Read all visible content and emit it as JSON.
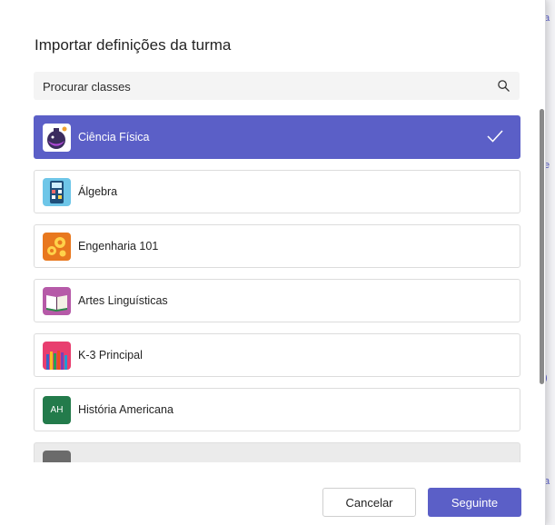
{
  "dialog": {
    "title": "Importar definições da turma",
    "search_placeholder": "Procurar classes",
    "cancel_label": "Cancelar",
    "next_label": "Seguinte"
  },
  "classes": [
    {
      "name": "Ciência Física",
      "icon": "flask-icon",
      "selected": true
    },
    {
      "name": "Álgebra",
      "icon": "calculator-icon",
      "selected": false
    },
    {
      "name": "Engenharia 101",
      "icon": "gears-icon",
      "selected": false
    },
    {
      "name": "Artes Linguísticas",
      "icon": "book-icon",
      "selected": false
    },
    {
      "name": "K-3 Principal",
      "icon": "pencils-icon",
      "selected": false
    },
    {
      "name": "História Americana",
      "icon": "initials-avatar",
      "initials": "AH",
      "selected": false
    }
  ],
  "colors": {
    "accent": "#5b5fc7",
    "initials_bg": "#237b4b"
  }
}
